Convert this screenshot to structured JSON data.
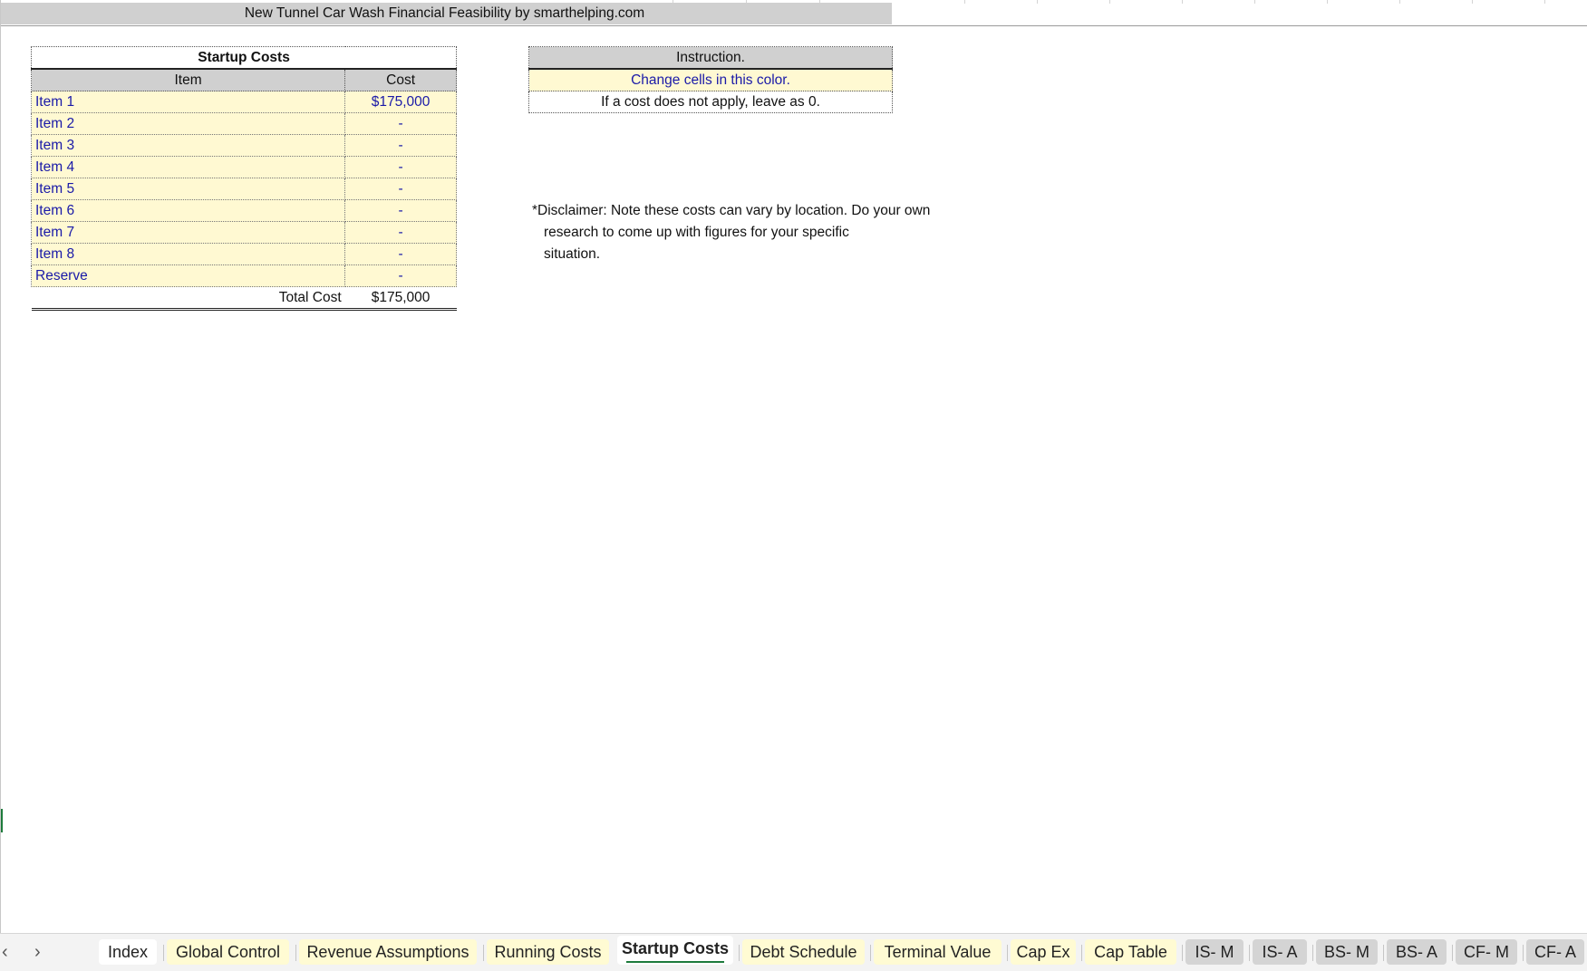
{
  "banner": {
    "title": "New Tunnel Car Wash Financial Feasibility by smarthelping.com"
  },
  "startup_table": {
    "title": "Startup Costs",
    "headers": {
      "item": "Item",
      "cost": "Cost"
    },
    "rows": [
      {
        "item": "Item 1",
        "cost": "$175,000"
      },
      {
        "item": "Item 2",
        "cost": "-"
      },
      {
        "item": "Item 3",
        "cost": "-"
      },
      {
        "item": "Item 4",
        "cost": "-"
      },
      {
        "item": "Item 5",
        "cost": "-"
      },
      {
        "item": "Item 6",
        "cost": "-"
      },
      {
        "item": "Item 7",
        "cost": "-"
      },
      {
        "item": "Item 8",
        "cost": "-"
      },
      {
        "item": "Reserve",
        "cost": "-"
      }
    ],
    "total": {
      "label": "Total Cost",
      "value": "$175,000"
    }
  },
  "instruction": {
    "header": "Instruction.",
    "line1": "Change cells in this color.",
    "line2": "If a cost does not apply, leave as 0."
  },
  "disclaimer": {
    "line1": "*Disclaimer: Note these costs can vary by location. Do your own",
    "line2": "research to come up with figures for your specific",
    "line3": "situation."
  },
  "tabs": {
    "prev_icon": "‹",
    "next_icon": "›",
    "items": [
      {
        "label": "Index",
        "color": "white"
      },
      {
        "label": "Global Control",
        "color": "yellow"
      },
      {
        "label": "Revenue Assumptions",
        "color": "yellow"
      },
      {
        "label": "Running Costs",
        "color": "yellow"
      },
      {
        "label": "Startup Costs",
        "color": "active"
      },
      {
        "label": "Debt Schedule",
        "color": "yellow"
      },
      {
        "label": "Terminal Value",
        "color": "yellow"
      },
      {
        "label": "Cap Ex",
        "color": "yellow"
      },
      {
        "label": "Cap Table",
        "color": "yellow"
      },
      {
        "label": "IS- M",
        "color": "gray"
      },
      {
        "label": "IS- A",
        "color": "gray"
      },
      {
        "label": "BS- M",
        "color": "gray"
      },
      {
        "label": "BS- A",
        "color": "gray"
      },
      {
        "label": "CF- M",
        "color": "gray"
      },
      {
        "label": "CF- A",
        "color": "gray"
      }
    ]
  },
  "colors": {
    "input_cell": "#fff9d2",
    "input_text": "#1a1aa8",
    "header_gray": "#d0d0d0",
    "active_tab_underline": "#1e7b3c"
  }
}
